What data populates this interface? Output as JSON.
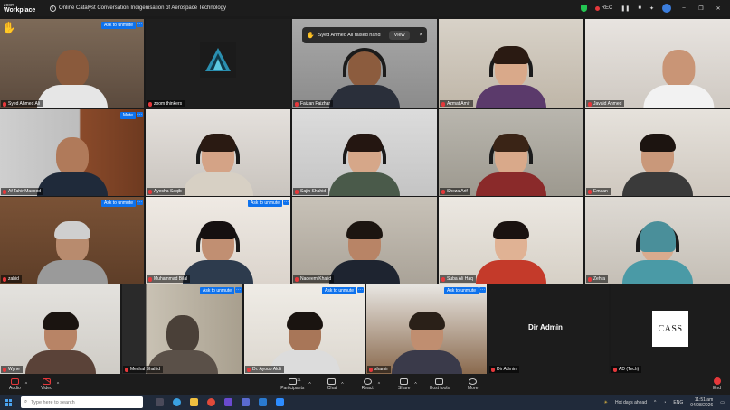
{
  "titlebar": {
    "brand_line1": "zoom",
    "brand_line2": "Workplace",
    "meeting_title": "Online Catalyst Conversation Indigenisation of Aerospace Technology",
    "rec_label": "REC"
  },
  "toast": {
    "message": "Syed Ahmed Ali raised hand",
    "view_label": "View",
    "close_label": "×"
  },
  "tiles": [
    {
      "name": "Syed Ahmed Ali",
      "button": "Ask to unmute"
    },
    {
      "name": "zoom thinkers"
    },
    {
      "name": "Faizan Faizhar"
    },
    {
      "name": "Azmat Amir"
    },
    {
      "name": "Javaid Ahmed"
    },
    {
      "name": "Af Tahir Masood",
      "button": "Mute"
    },
    {
      "name": "Ayesha Saqib"
    },
    {
      "name": "Sajin Shahid"
    },
    {
      "name": "Sheza Arif"
    },
    {
      "name": "Emaan"
    },
    {
      "name": "zahid",
      "button": "Ask to unmute"
    },
    {
      "name": "Muhammad Bilal",
      "button": "Ask to unmute"
    },
    {
      "name": "Nadeem Khalid"
    },
    {
      "name": "Suba Ali Haq"
    },
    {
      "name": "Zehra"
    },
    {
      "name": "Wyne"
    },
    {
      "name": "Meshal Shahid",
      "button": "Ask to unmute"
    },
    {
      "name": "Dr. Ayoub Aldli",
      "button": "Ask to unmute"
    },
    {
      "name": "shamir",
      "button": "Ask to unmute"
    },
    {
      "name": "Dir Admin",
      "big_label": "Dir Admin"
    },
    {
      "name": "AD (Tech)",
      "logo_text": "CASS"
    }
  ],
  "controls": {
    "audio": "Audio",
    "video": "Video",
    "participants": "Participants",
    "participants_count": "21",
    "chat": "Chat",
    "react": "React",
    "share": "Share",
    "host_tools": "Host tools",
    "more": "More",
    "end": "End"
  },
  "taskbar": {
    "search_placeholder": "Type here to search",
    "weather": "Hot days ahead",
    "lang": "ENG",
    "time": "11:51 am",
    "date": "04/08/2026"
  },
  "colors": {
    "accent": "#0e72ed",
    "active_speaker": "#23d160",
    "muted": "#e5383b"
  }
}
